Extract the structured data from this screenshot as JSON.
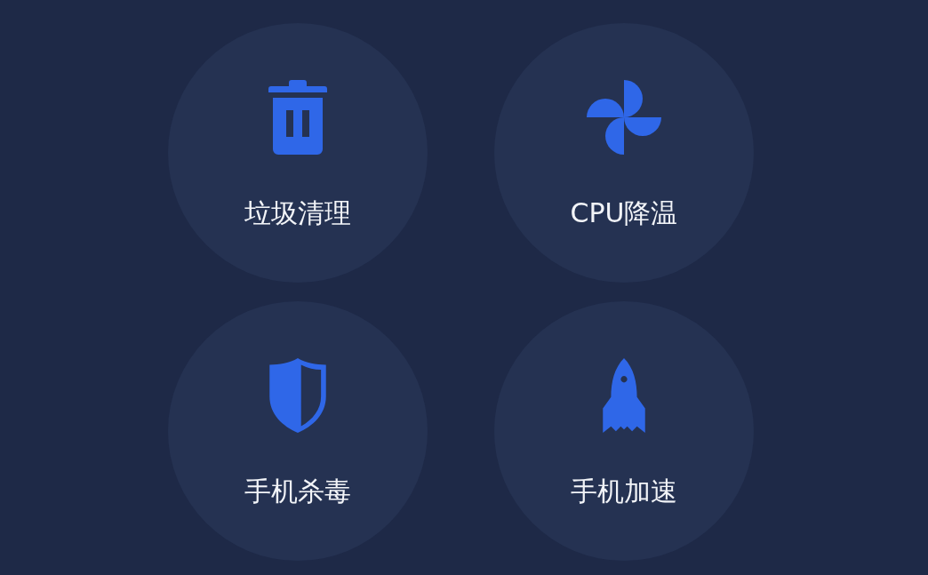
{
  "tools": [
    {
      "kind": "trash",
      "label": "垃圾清理"
    },
    {
      "kind": "fan",
      "label": "CPU降温"
    },
    {
      "kind": "shield",
      "label": "手机杀毒"
    },
    {
      "kind": "rocket",
      "label": "手机加速"
    }
  ]
}
